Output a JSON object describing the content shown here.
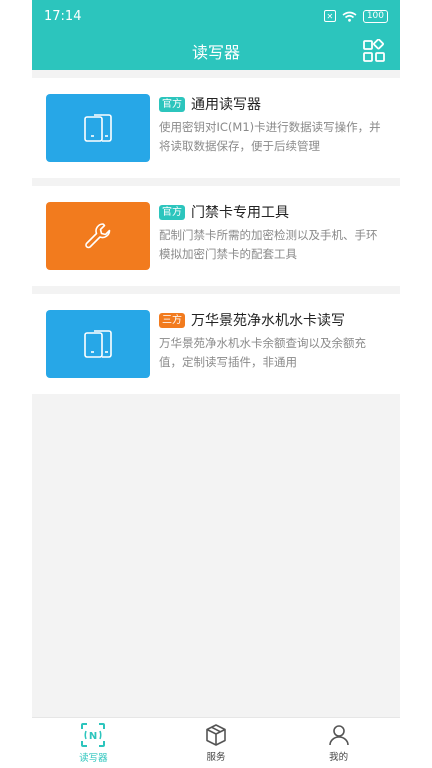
{
  "status": {
    "time": "17:14",
    "battery": "100"
  },
  "header": {
    "title": "读写器",
    "grid_icon": "grid-apps-icon"
  },
  "colors": {
    "accent": "#2cc5bd",
    "blue": "#27a7e7",
    "orange": "#f27b1e",
    "tag_official": "#2cc5bd",
    "tag_third": "#f27b1e"
  },
  "cards": [
    {
      "tag": "官方",
      "title": "通用读写器",
      "desc": "使用密钥对IC(M1)卡进行数据读写操作，并将读取数据保存，便于后续管理",
      "icon": "phone-sim-icon"
    },
    {
      "tag": "官方",
      "title": "门禁卡专用工具",
      "desc": "配制门禁卡所需的加密检测以及手机、手环模拟加密门禁卡的配套工具",
      "icon": "wrench-icon"
    },
    {
      "tag": "三方",
      "title": "万华景苑净水机水卡读写",
      "desc": "万华景苑净水机水卡余额查询以及余额充值，定制读写插件，非通用",
      "icon": "phone-sim-icon"
    }
  ],
  "tabs": [
    {
      "label": "读写器",
      "icon": "nfc-icon"
    },
    {
      "label": "服务",
      "icon": "box-icon"
    },
    {
      "label": "我的",
      "icon": "user-icon"
    }
  ]
}
